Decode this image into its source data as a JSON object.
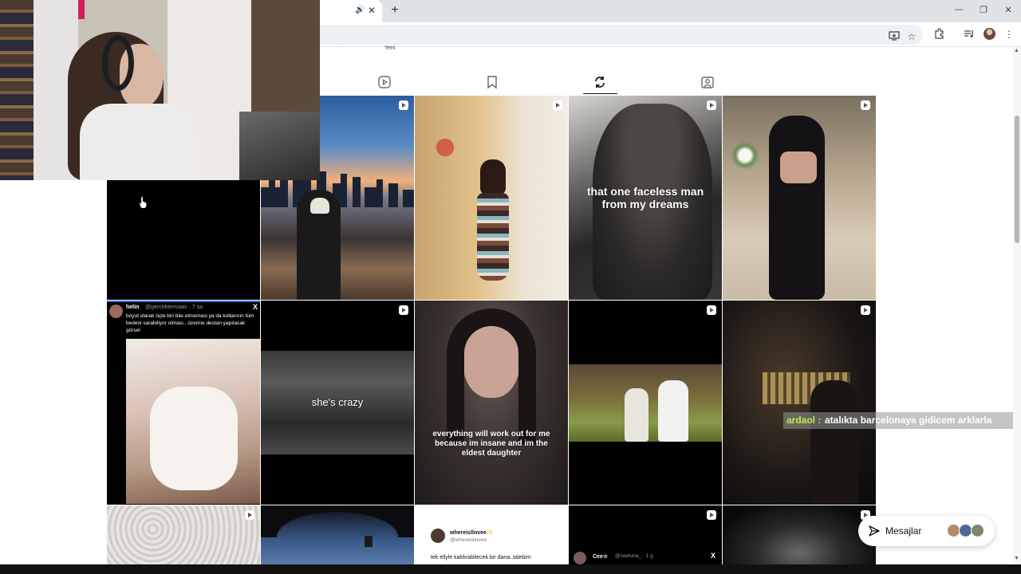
{
  "browser": {
    "tab_audio_icon": "speaker-icon",
    "tab_close": "✕",
    "new_tab": "+",
    "window_controls": {
      "minimize": "—",
      "restore": "❐",
      "close": "✕"
    },
    "toolbar_icons": [
      "install-app-icon",
      "star-icon",
      "extensions-icon",
      "media-icon",
      "profile-avatar",
      "menu-icon"
    ]
  },
  "page": {
    "cut_label": "Yeni",
    "cut_dot": "·",
    "profile_tabs": [
      "reels-tab",
      "saved-tab",
      "reposts-tab",
      "tagged-tab"
    ],
    "active_tab": "reposts-tab"
  },
  "grid": {
    "captions": {
      "faceless": "that one faceless man from my dreams",
      "crazy": "she's crazy",
      "eldest": "everything will work out for me because im insane and im the eldest daughter"
    },
    "tweet1": {
      "name": "helin",
      "handle": "@gercektenvaav · 7 sa",
      "text": "boyut olarak üçte biri bile etmemesi ya da kollarının tüm bedeni sarabiliyor olması.. üzerine destan yapılacak görsel",
      "platform": "X"
    },
    "tweet2": {
      "name": "whereisllovee✨",
      "handle": "@whereisllovee",
      "text": "tek ellyle kaldırabilecek bir dana..talebim"
    },
    "tweet3": {
      "name": "Cee☆",
      "handle": "@ceeluna_ · 1 g",
      "platform": "X"
    }
  },
  "chat": {
    "user": "ardaol :",
    "message": "atalıkta barcelonaya gidicem arklarla"
  },
  "messages": {
    "label": "Mesajlar"
  }
}
